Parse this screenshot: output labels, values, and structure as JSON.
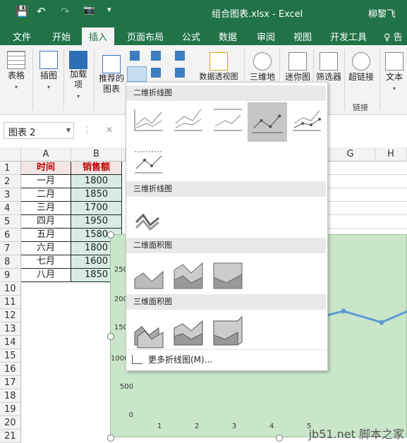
{
  "titlebar": {
    "title": "组合图表.xlsx  -  Excel",
    "user": "柳黎飞",
    "save_icon": "💾",
    "undo_icon": "↶",
    "redo_icon": "↷",
    "camera_icon": "📷",
    "more_icon": "▾"
  },
  "tabs": [
    "文件",
    "开始",
    "插入",
    "页面布局",
    "公式",
    "数据",
    "审阅",
    "视图",
    "开发工具",
    "♀ 告"
  ],
  "active_tab": "插入",
  "ribbon": {
    "table": "表格",
    "illustration": "插图",
    "addins": "加载项",
    "recommended": "推荐的图表",
    "pivotchart": "数据透视图",
    "map3d": "三维地",
    "sparkline": "迷你图",
    "slicer": "筛选器",
    "hyperlink": "超链接",
    "text": "文本",
    "links_group": "链接"
  },
  "namebox": {
    "value": "图表 2",
    "cancel": "✕"
  },
  "columns": [
    "A",
    "B",
    "G",
    "H"
  ],
  "rows": [
    "1",
    "2",
    "3",
    "4",
    "5",
    "6",
    "7",
    "8",
    "9",
    "10",
    "11",
    "12",
    "13",
    "14",
    "15",
    "16",
    "17",
    "18",
    "19",
    "20",
    "21"
  ],
  "table": {
    "headers": [
      "时间",
      "销售额"
    ],
    "rows": [
      [
        "一月",
        "1800"
      ],
      [
        "二月",
        "1850"
      ],
      [
        "三月",
        "1700"
      ],
      [
        "四月",
        "1950"
      ],
      [
        "五月",
        "1580"
      ],
      [
        "六月",
        "1800"
      ],
      [
        "七月",
        "1600"
      ],
      [
        "八月",
        "1850"
      ]
    ]
  },
  "chart": {
    "yticks": [
      "250",
      "200",
      "150",
      "1000",
      "500",
      "0"
    ],
    "xticks": [
      "1",
      "2",
      "3",
      "4",
      "5"
    ]
  },
  "dropdown": {
    "section1": "二维折线图",
    "section2": "三维折线图",
    "section3": "二维面积图",
    "section4": "三维面积图",
    "more": "更多折线图(M)..."
  },
  "watermark": "jb51.net 脚本之家"
}
